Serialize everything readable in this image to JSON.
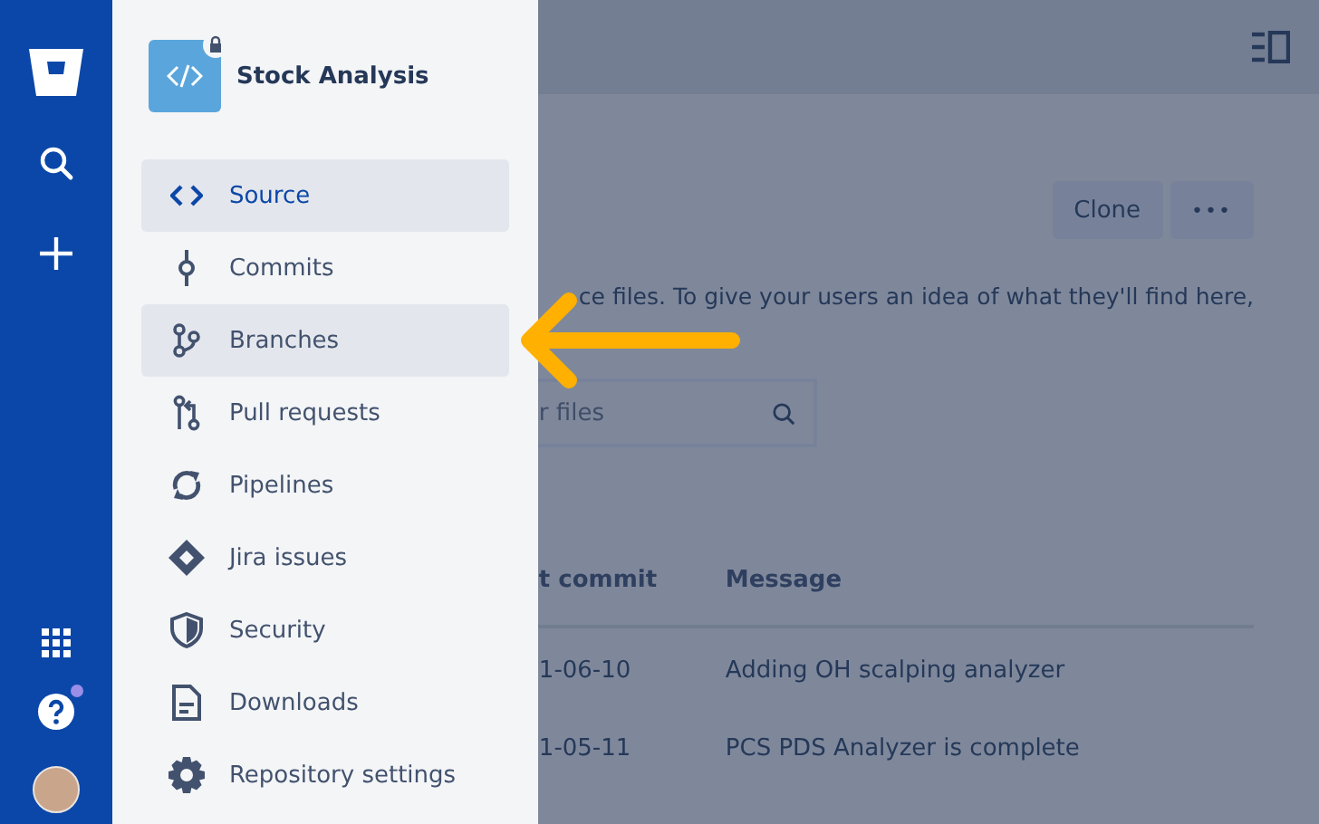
{
  "project": {
    "name": "Stock Analysis",
    "private": true
  },
  "nav": [
    {
      "label": "Source",
      "selected": true,
      "highlighted": true
    },
    {
      "label": "Commits",
      "selected": false,
      "highlighted": false
    },
    {
      "label": "Branches",
      "selected": false,
      "highlighted": true
    },
    {
      "label": "Pull requests",
      "selected": false,
      "highlighted": false
    },
    {
      "label": "Pipelines",
      "selected": false,
      "highlighted": false
    },
    {
      "label": "Jira issues",
      "selected": false,
      "highlighted": false
    },
    {
      "label": "Security",
      "selected": false,
      "highlighted": false
    },
    {
      "label": "Downloads",
      "selected": false,
      "highlighted": false
    },
    {
      "label": "Repository settings",
      "selected": false,
      "highlighted": false
    }
  ],
  "help": {
    "notification": true
  },
  "actions": {
    "clone": "Clone",
    "more": "•••"
  },
  "description": "ce files. To give your users an idea of what they'll find here,",
  "search": {
    "placeholder": "r files"
  },
  "table": {
    "columns": [
      "t commit",
      "Message"
    ],
    "rows": [
      {
        "cells": [
          "1-06-10",
          "Adding OH scalping analyzer"
        ]
      },
      {
        "cells": [
          "1-05-11",
          "PCS PDS Analyzer is complete"
        ]
      }
    ]
  }
}
